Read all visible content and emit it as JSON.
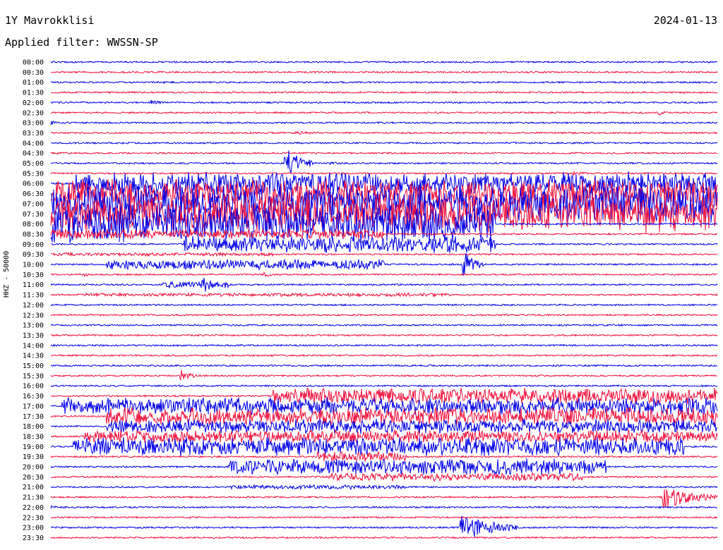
{
  "header": {
    "station": "1Y Mavrokklisi",
    "date": "2024-01-13",
    "filter": "Applied filter: WWSSN-SP"
  },
  "colors": {
    "trace_a": "#0000e6",
    "trace_b": "#f0103c"
  },
  "chart_data": {
    "type": "line",
    "title": "1Y Mavrokklisi",
    "ylabel": "HHZ - 50000",
    "x_unit": "minutes within row",
    "xlim": [
      0,
      30
    ],
    "row_labels": [
      "00:00",
      "00:30",
      "01:00",
      "01:30",
      "02:00",
      "02:30",
      "03:00",
      "03:30",
      "04:00",
      "04:30",
      "05:00",
      "05:30",
      "06:00",
      "06:30",
      "07:00",
      "07:30",
      "08:00",
      "08:30",
      "09:00",
      "09:30",
      "10:00",
      "10:30",
      "11:00",
      "11:30",
      "12:00",
      "12:30",
      "13:00",
      "13:30",
      "14:00",
      "14:30",
      "15:00",
      "15:30",
      "16:00",
      "16:30",
      "17:00",
      "17:30",
      "18:00",
      "18:30",
      "19:00",
      "19:30",
      "20:00",
      "20:30",
      "21:00",
      "21:30",
      "22:00",
      "22:30",
      "23:00",
      "23:30"
    ],
    "row_colors": [
      "#0000e6",
      "#f0103c"
    ],
    "activity": [
      {
        "row": "02:00",
        "start_min": 4.5,
        "end_min": 5.2,
        "amp": 0.25
      },
      {
        "row": "02:30",
        "start_min": 27.3,
        "end_min": 27.8,
        "amp": 0.25
      },
      {
        "row": "03:00",
        "start_min": 0.0,
        "end_min": 0.5,
        "amp": 0.2
      },
      {
        "row": "03:30",
        "start_min": 11.0,
        "end_min": 12.8,
        "amp": 0.15
      },
      {
        "row": "05:00",
        "start_min": 12.5,
        "end_min": 13.5,
        "amp": 0.12
      },
      {
        "row": "05:00",
        "start_min": 10.5,
        "end_min": 11.8,
        "amp": 1.2
      },
      {
        "row": "05:30",
        "start_min": 23.5,
        "end_min": 24.5,
        "amp": 0.2
      },
      {
        "row": "06:00",
        "start_min": 1.0,
        "end_min": 30.0,
        "amp": 0.8
      },
      {
        "row": "06:30",
        "start_min": 0.0,
        "end_min": 30.0,
        "amp": 1.0
      },
      {
        "row": "07:00",
        "start_min": 0.0,
        "end_min": 30.0,
        "amp": 1.3
      },
      {
        "row": "07:30",
        "start_min": 0.0,
        "end_min": 30.0,
        "amp": 1.3
      },
      {
        "row": "08:00",
        "start_min": 0.0,
        "end_min": 20.0,
        "amp": 1.3
      },
      {
        "row": "08:30",
        "start_min": 0.0,
        "end_min": 15.0,
        "amp": 0.35
      },
      {
        "row": "09:00",
        "start_min": 6.0,
        "end_min": 20.0,
        "amp": 0.6
      },
      {
        "row": "09:30",
        "start_min": 0.0,
        "end_min": 10.0,
        "amp": 0.12
      },
      {
        "row": "10:00",
        "start_min": 2.5,
        "end_min": 15.0,
        "amp": 0.35
      },
      {
        "row": "10:00",
        "start_min": 18.5,
        "end_min": 19.5,
        "amp": 1.1
      },
      {
        "row": "10:30",
        "start_min": 1.5,
        "end_min": 2.0,
        "amp": 0.2
      },
      {
        "row": "10:30",
        "start_min": 9.5,
        "end_min": 10.3,
        "amp": 0.25
      },
      {
        "row": "11:00",
        "start_min": 5.0,
        "end_min": 8.0,
        "amp": 0.25
      },
      {
        "row": "11:00",
        "start_min": 6.8,
        "end_min": 7.4,
        "amp": 1.0
      },
      {
        "row": "11:30",
        "start_min": 1.5,
        "end_min": 18.0,
        "amp": 0.12
      },
      {
        "row": "15:30",
        "start_min": 5.8,
        "end_min": 6.6,
        "amp": 0.5
      },
      {
        "row": "16:30",
        "start_min": 10.0,
        "end_min": 30.0,
        "amp": 0.55
      },
      {
        "row": "17:00",
        "start_min": 0.5,
        "end_min": 30.0,
        "amp": 0.6
      },
      {
        "row": "17:30",
        "start_min": 2.5,
        "end_min": 30.0,
        "amp": 0.6
      },
      {
        "row": "18:00",
        "start_min": 2.5,
        "end_min": 30.0,
        "amp": 0.5
      },
      {
        "row": "18:30",
        "start_min": 1.5,
        "end_min": 30.0,
        "amp": 0.45
      },
      {
        "row": "19:00",
        "start_min": 1.0,
        "end_min": 28.5,
        "amp": 0.65
      },
      {
        "row": "19:30",
        "start_min": 12.0,
        "end_min": 16.0,
        "amp": 0.35
      },
      {
        "row": "20:00",
        "start_min": 8.0,
        "end_min": 25.0,
        "amp": 0.55
      },
      {
        "row": "20:30",
        "start_min": 12.5,
        "end_min": 24.0,
        "amp": 0.3
      },
      {
        "row": "21:00",
        "start_min": 8.0,
        "end_min": 16.0,
        "amp": 0.15
      },
      {
        "row": "21:30",
        "start_min": 27.5,
        "end_min": 30.0,
        "amp": 0.9
      },
      {
        "row": "22:00",
        "start_min": 0.0,
        "end_min": 0.3,
        "amp": 0.25
      },
      {
        "row": "23:00",
        "start_min": 18.4,
        "end_min": 21.0,
        "amp": 1.1
      }
    ]
  }
}
